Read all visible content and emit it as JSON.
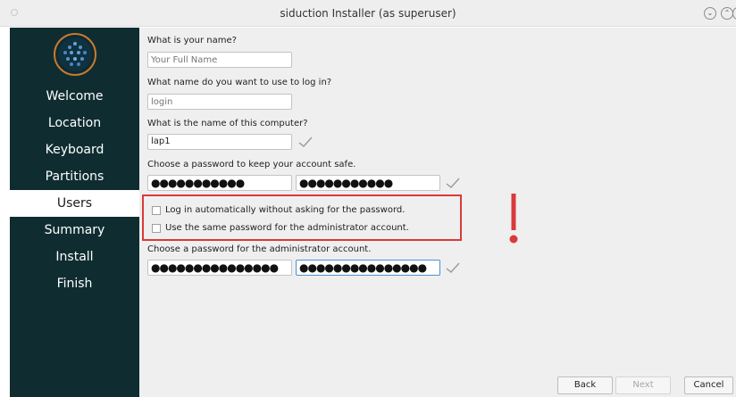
{
  "window": {
    "title": "siduction Installer (as superuser)"
  },
  "sidebar": {
    "items": [
      {
        "label": "Welcome"
      },
      {
        "label": "Location"
      },
      {
        "label": "Keyboard"
      },
      {
        "label": "Partitions"
      },
      {
        "label": "Users",
        "active": true
      },
      {
        "label": "Summary"
      },
      {
        "label": "Install"
      },
      {
        "label": "Finish"
      }
    ]
  },
  "form": {
    "name": {
      "question": "What is your name?",
      "placeholder": "Your Full Name",
      "value": ""
    },
    "login": {
      "question": "What name do you want to use to log in?",
      "placeholder": "login",
      "value": ""
    },
    "hostname": {
      "question": "What is the name of this computer?",
      "value": "lap1"
    },
    "password": {
      "question": "Choose a password to keep your account safe.",
      "value": "●●●●●●●●●●●",
      "confirm": "●●●●●●●●●●●"
    },
    "autologin": {
      "label": "Log in automatically without asking for the password.",
      "checked": false
    },
    "same_password": {
      "label": "Use the same password for the administrator account.",
      "checked": false
    },
    "admin_password": {
      "question": "Choose a password for the administrator account.",
      "value": "●●●●●●●●●●●●●●●",
      "confirm": "●●●●●●●●●●●●●●●"
    }
  },
  "buttons": {
    "back": "Back",
    "next": "Next",
    "cancel": "Cancel"
  },
  "colors": {
    "sidebar_bg": "#0f2d31",
    "highlight": "#d93a3a",
    "checkmark": "#9a9a9a"
  }
}
